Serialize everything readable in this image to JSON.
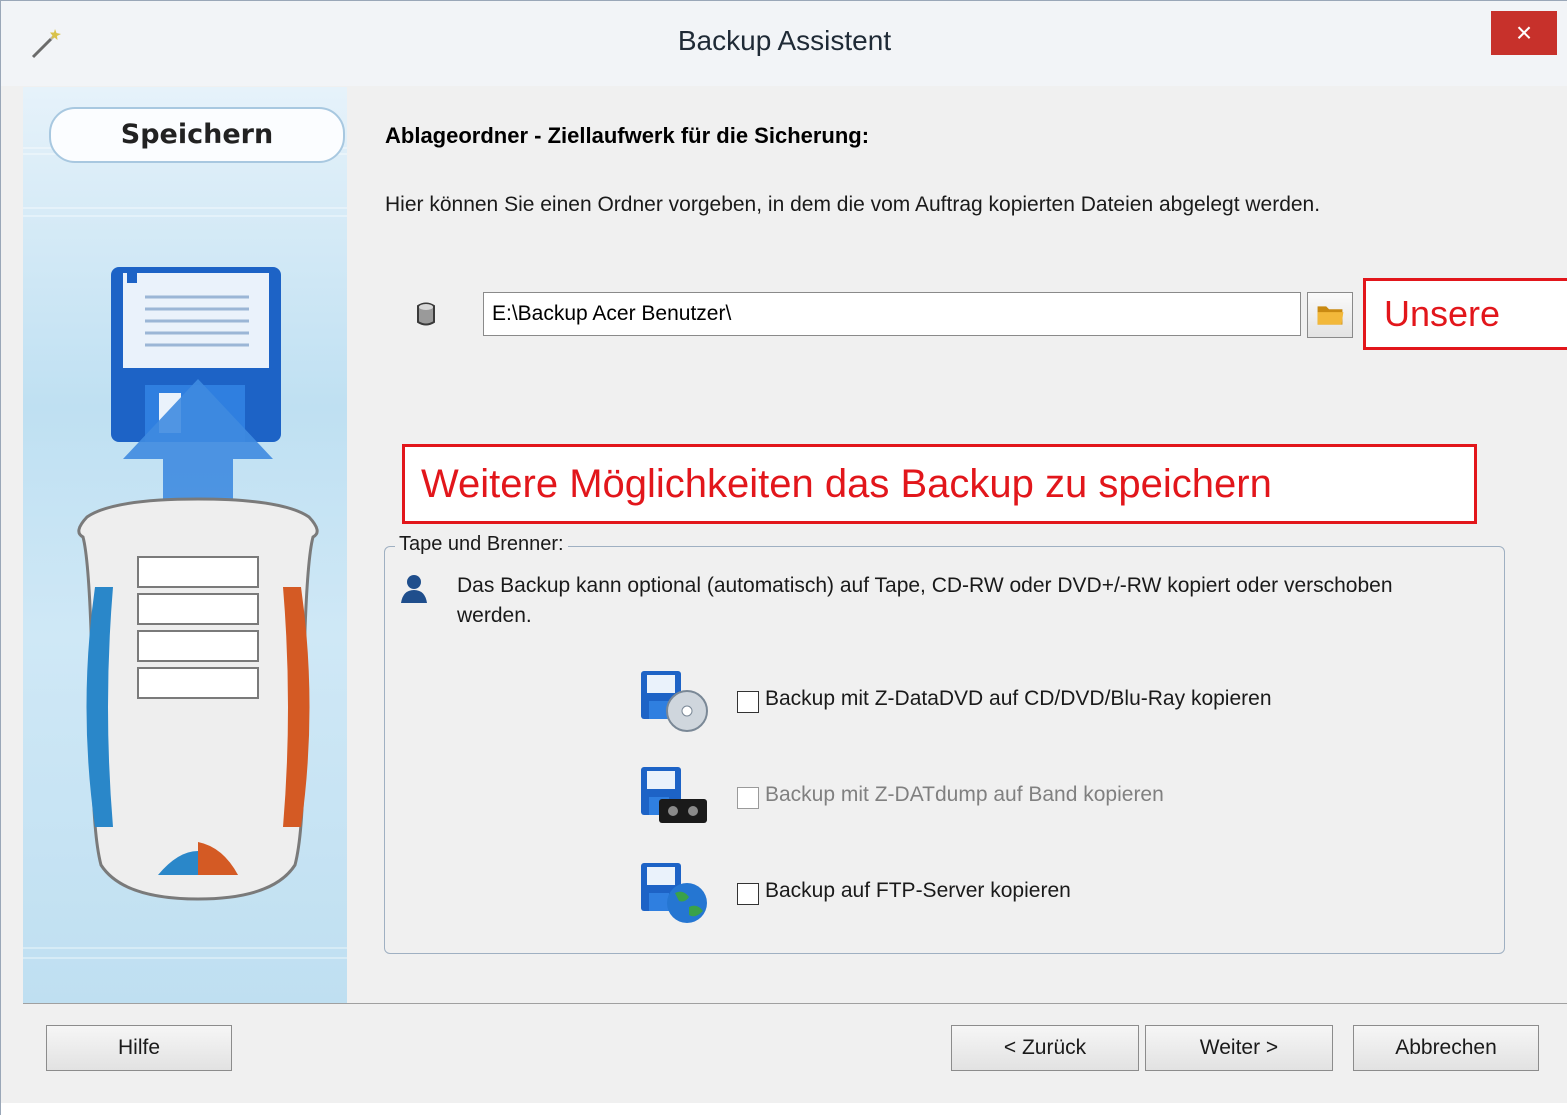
{
  "window": {
    "title": "Backup Assistent",
    "close_label": "×"
  },
  "sidebar": {
    "step_label": "Speichern"
  },
  "main": {
    "heading": "Ablageordner - Ziellaufwerk für die Sicherung:",
    "description": "Hier können Sie einen Ordner vorgeben, in dem die vom Auftrag kopierten Dateien abgelegt werden.",
    "path_value": "E:\\Backup Acer Benutzer\\"
  },
  "annotations": {
    "callout_right": "Unsere",
    "callout_main": "Weitere Möglichkeiten das Backup zu speichern"
  },
  "group": {
    "legend": "Tape und Brenner:",
    "description": "Das Backup kann optional (automatisch) auf Tape, CD-RW oder DVD+/-RW kopiert oder verschoben werden.",
    "options": [
      {
        "label": "Backup mit Z-DataDVD auf CD/DVD/Blu-Ray kopieren",
        "checked": false,
        "enabled": true
      },
      {
        "label": "Backup mit Z-DATdump auf Band kopieren",
        "checked": false,
        "enabled": false
      },
      {
        "label": "Backup auf FTP-Server kopieren",
        "checked": false,
        "enabled": true
      }
    ]
  },
  "footer": {
    "help_label": "Hilfe",
    "back_label": "< Zurück",
    "next_label": "Weiter >",
    "cancel_label": "Abbrechen"
  },
  "colors": {
    "annotation_red": "#e2161b",
    "close_red": "#c7312b",
    "side_blue": "#bfe0f2"
  },
  "icons": [
    "wand-icon",
    "drive-icon",
    "folder-icon",
    "user-icon",
    "disk-cd-icon",
    "disk-tape-icon",
    "disk-globe-icon",
    "floppy-illustration"
  ]
}
